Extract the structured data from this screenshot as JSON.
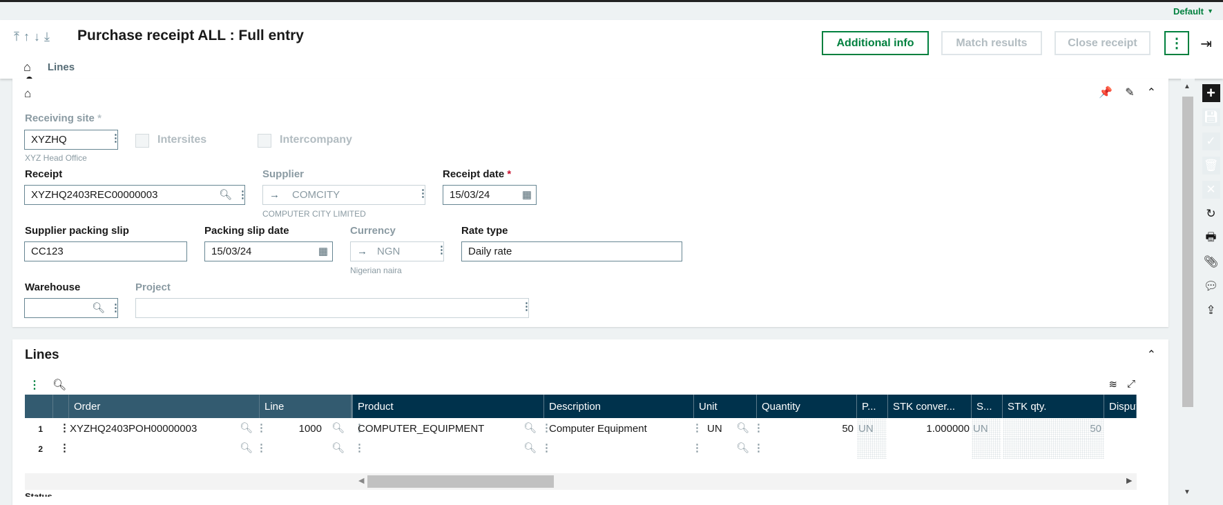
{
  "userbar": {
    "profile": "Default"
  },
  "header": {
    "title": "Purchase receipt ALL : Full entry",
    "buttons": {
      "additional_info": "Additional info",
      "match_results": "Match results",
      "close_receipt": "Close receipt"
    },
    "tabs": [
      "Lines"
    ]
  },
  "form": {
    "receiving_site": {
      "label": "Receiving site",
      "value": "XYZHQ",
      "description": "XYZ Head Office"
    },
    "intersites": {
      "label": "Intersites",
      "checked": false
    },
    "intercompany": {
      "label": "Intercompany",
      "checked": false
    },
    "receipt": {
      "label": "Receipt",
      "value": "XYZHQ2403REC00000003"
    },
    "supplier": {
      "label": "Supplier",
      "value": "COMCITY",
      "description": "COMPUTER CITY LIMITED"
    },
    "receipt_date": {
      "label": "Receipt date",
      "value": "15/03/24"
    },
    "supplier_packing_slip": {
      "label": "Supplier packing slip",
      "value": "CC123"
    },
    "packing_slip_date": {
      "label": "Packing slip date",
      "value": "15/03/24"
    },
    "currency": {
      "label": "Currency",
      "value": "NGN",
      "description": "Nigerian naira"
    },
    "rate_type": {
      "label": "Rate type",
      "value": "Daily rate"
    },
    "warehouse": {
      "label": "Warehouse",
      "value": ""
    },
    "project": {
      "label": "Project",
      "value": ""
    }
  },
  "lines": {
    "title": "Lines",
    "columns": [
      "Order",
      "Line",
      "Product",
      "Description",
      "Unit",
      "Quantity",
      "P...",
      "STK conver...",
      "S...",
      "STK qty.",
      "Disput"
    ],
    "rows": [
      {
        "num": "1",
        "order": "XYZHQ2403POH00000003",
        "line": "1000",
        "product": "COMPUTER_EQUIPMENT",
        "description": "Computer Equipment",
        "unit": "UN",
        "quantity": "50",
        "pu": "UN",
        "stk_conv": "1.000000",
        "su": "UN",
        "stk_qty": "50"
      },
      {
        "num": "2",
        "order": "",
        "line": "",
        "product": "",
        "description": "",
        "unit": "",
        "quantity": "",
        "pu": "",
        "stk_conv": "",
        "su": "",
        "stk_qty": ""
      }
    ]
  },
  "next_section_label": "Status"
}
